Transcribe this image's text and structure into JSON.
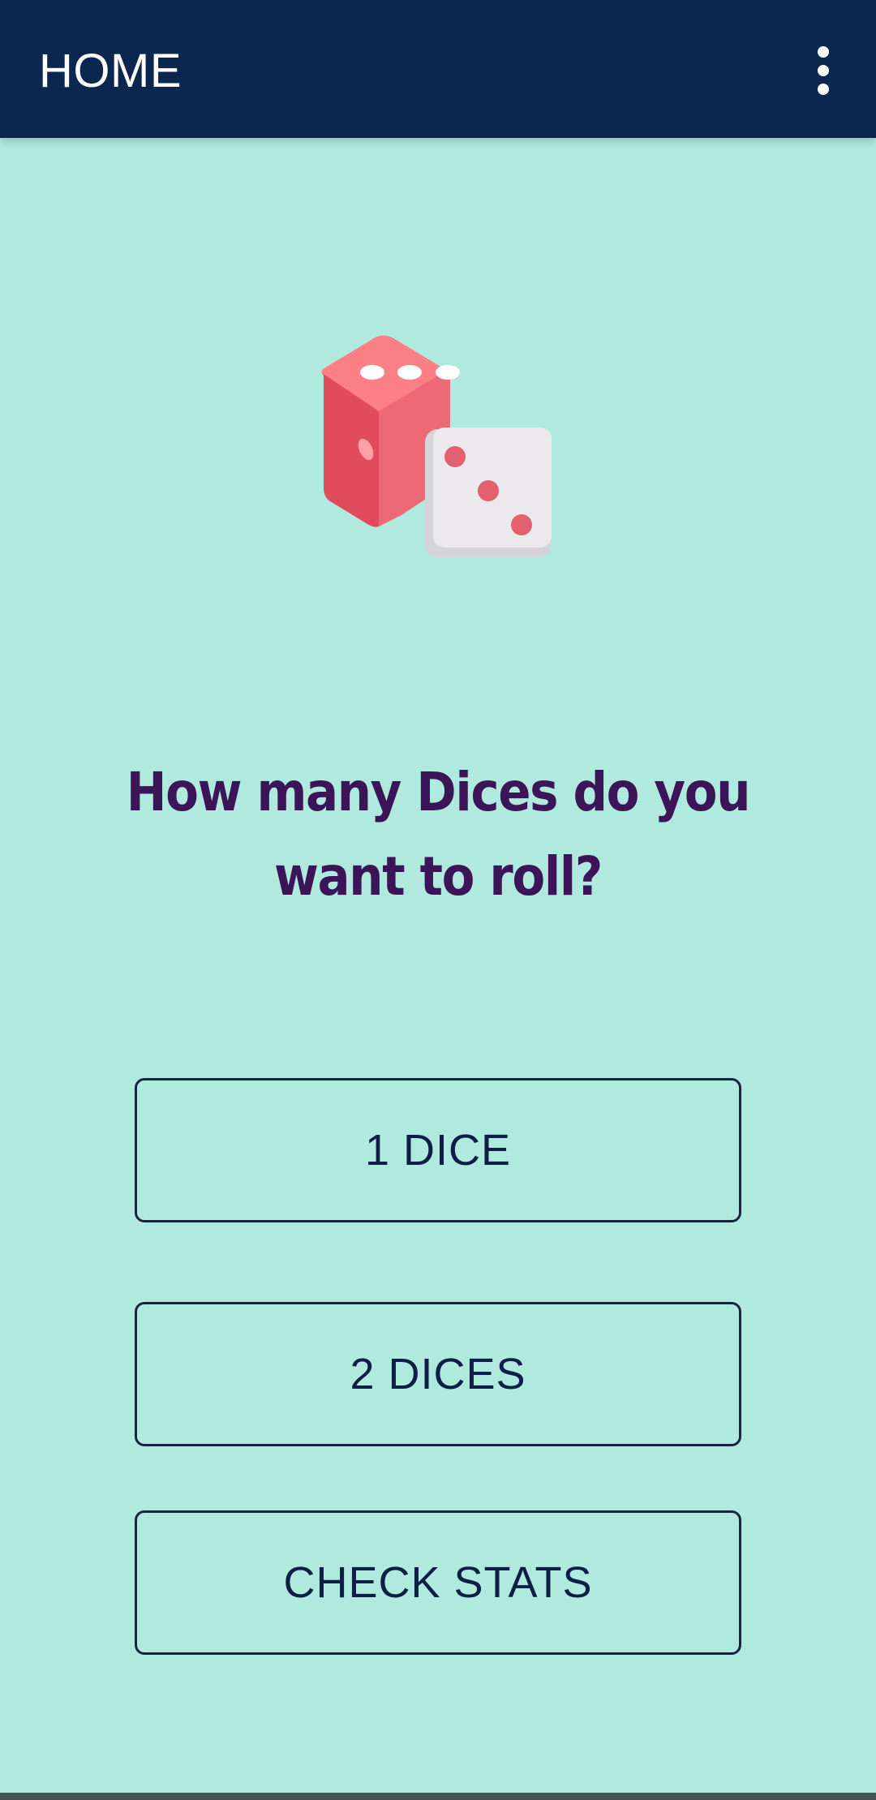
{
  "app_bar": {
    "title": "HOME",
    "overflow_icon": "more-vert-icon",
    "background_color": "#0b264f"
  },
  "hero": {
    "icon": "dice-icon"
  },
  "question": "How many Dices do you want to roll?",
  "buttons": {
    "one_dice": "1 DICE",
    "two_dices": "2 DICES",
    "check_stats": "CHECK STATS"
  },
  "colors": {
    "background": "#b0e9dd",
    "question_text": "#3c1558",
    "button_text": "#0d1f45"
  }
}
